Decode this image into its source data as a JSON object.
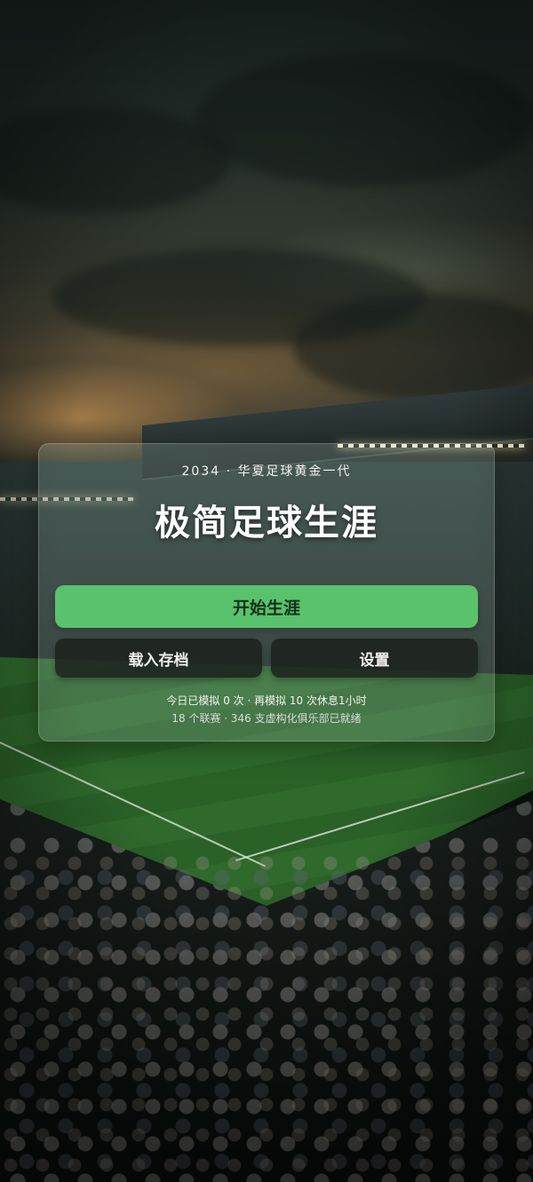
{
  "card": {
    "subtitle": "2034 · 华夏足球黄金一代",
    "title": "极简足球生涯",
    "start_button": "开始生涯",
    "load_button": "载入存档",
    "settings_button": "设置",
    "stat_line": "今日已模拟 0 次 · 再模拟 10 次休息1小时",
    "info_line": "18 个联赛 · 346 支虚构化俱乐部已就绪"
  },
  "colors": {
    "primary_button": "#59c26c",
    "dark_button": "#1c221f"
  }
}
